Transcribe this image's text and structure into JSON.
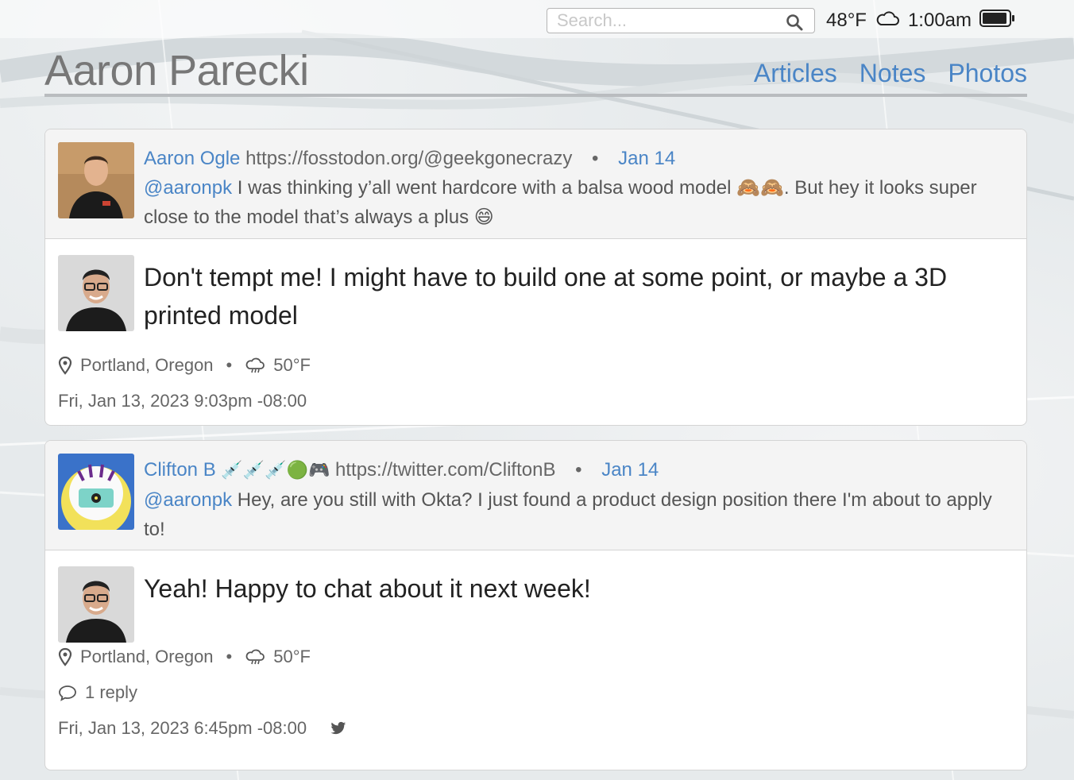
{
  "search": {
    "placeholder": "Search..."
  },
  "status": {
    "temperature": "48°F",
    "weather_icon": "cloud-icon",
    "time": "1:00am",
    "battery_icon": "battery-icon"
  },
  "site": {
    "title": "Aaron Parecki"
  },
  "nav": [
    {
      "label": "Articles"
    },
    {
      "label": "Notes"
    },
    {
      "label": "Photos"
    }
  ],
  "posts": [
    {
      "context": {
        "author": "Aaron Ogle",
        "url": "https://fosstodon.org/@geekgonecrazy",
        "separator": "•",
        "date": "Jan 14",
        "mention": "@aaronpk",
        "text": " I was thinking y’all went hardcore with a balsa wood model 🙈🙈. But hey it looks super close to the model that’s always a plus 😄"
      },
      "text": "Don't tempt me! I might have to build one at some point, or maybe a 3D printed model",
      "location": "Portland, Oregon",
      "separator": "•",
      "weather": "50°F",
      "timestamp": "Fri, Jan 13, 2023 9:03pm -08:00"
    },
    {
      "context": {
        "author": "Clifton B",
        "author_emoji": "💉💉💉🟢🎮",
        "url": "https://twitter.com/CliftonB",
        "separator": "•",
        "date": "Jan 14",
        "mention": "@aaronpk",
        "text": " Hey, are you still with Okta? I just found a product design position there I'm about to apply to!"
      },
      "text": "Yeah! Happy to chat about it next week!",
      "location": "Portland, Oregon",
      "separator": "•",
      "weather": "50°F",
      "replies": "1 reply",
      "timestamp": "Fri, Jan 13, 2023 6:45pm -08:00",
      "syndication_icon": "twitter-icon"
    }
  ]
}
